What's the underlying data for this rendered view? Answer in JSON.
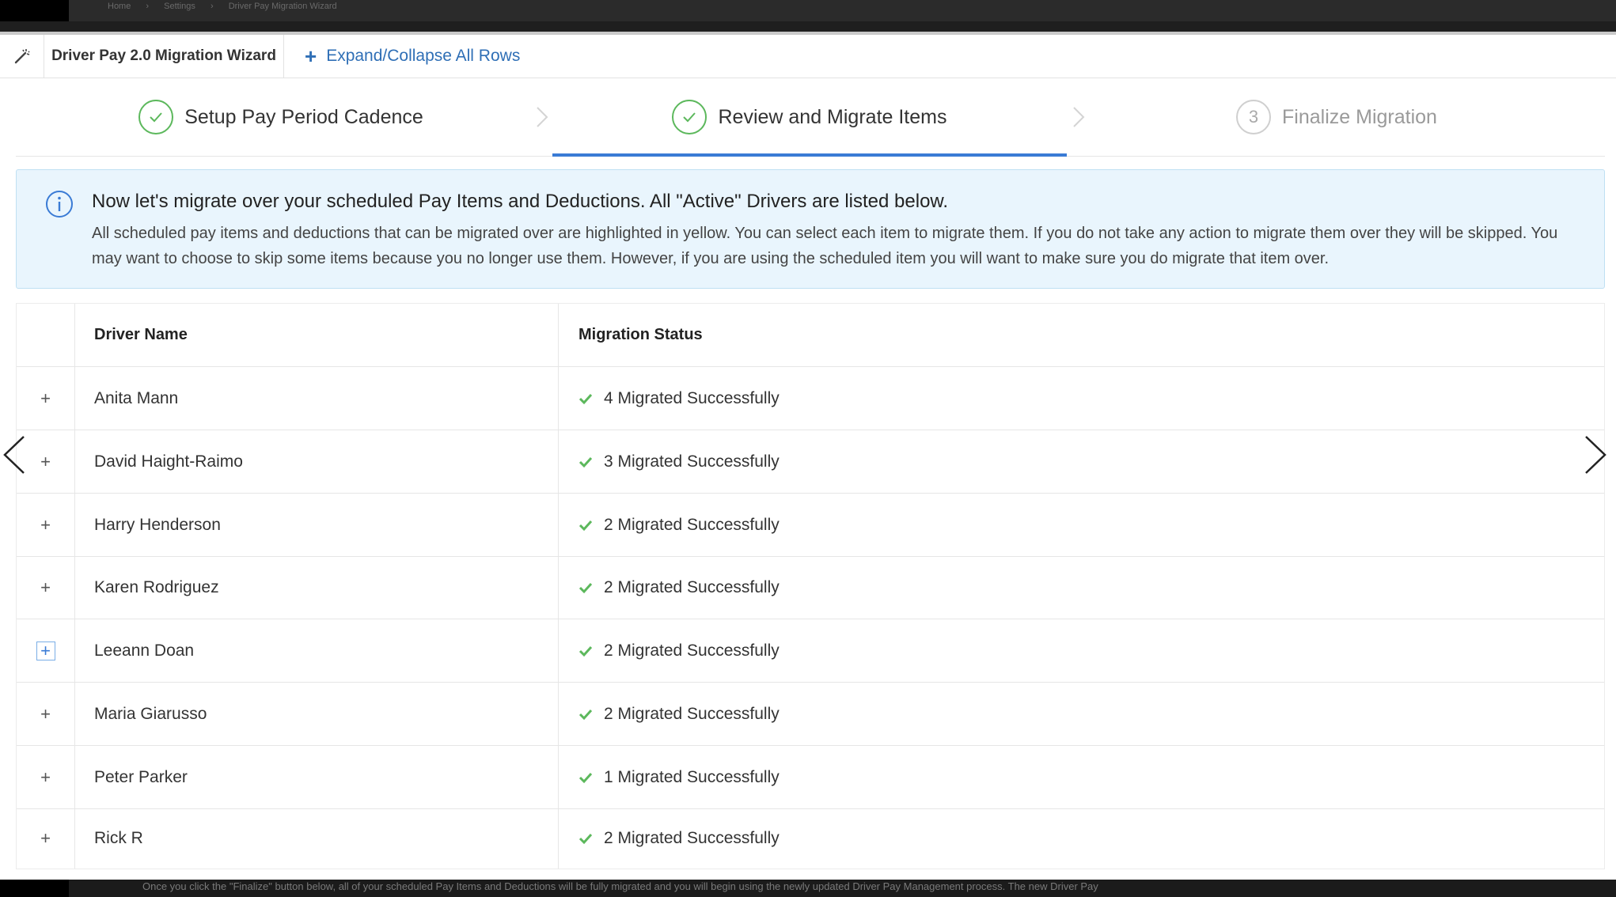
{
  "topbar": {
    "breadcrumbs": [
      "Home",
      "Settings",
      "Driver Pay Migration Wizard"
    ]
  },
  "header": {
    "icon": "magic-wand-icon",
    "title": "Driver Pay 2.0 Migration Wizard",
    "expand_label": "Expand/Collapse All Rows"
  },
  "steps": [
    {
      "label": "Setup Pay Period Cadence",
      "state": "complete"
    },
    {
      "label": "Review and Migrate Items",
      "state": "active"
    },
    {
      "label": "Finalize Migration",
      "state": "pending",
      "number": "3"
    }
  ],
  "info": {
    "title": "Now let's migrate over your scheduled Pay Items and Deductions. All \"Active\" Drivers are listed below.",
    "body": "All scheduled pay items and deductions that can be migrated over are highlighted in yellow. You can select each item to migrate them. If you do not take any action to migrate them over they will be skipped. You may want to choose to skip some items because you no longer use them. However, if you are using the scheduled item you will want to make sure you do migrate that item over."
  },
  "table": {
    "columns": {
      "name": "Driver Name",
      "status": "Migration Status"
    },
    "rows": [
      {
        "name": "Anita Mann",
        "status": "4 Migrated Successfully"
      },
      {
        "name": "David Haight-Raimo",
        "status": "3 Migrated Successfully"
      },
      {
        "name": "Harry Henderson",
        "status": "2 Migrated Successfully"
      },
      {
        "name": "Karen Rodriguez",
        "status": "2 Migrated Successfully"
      },
      {
        "name": "Leeann Doan",
        "status": "2 Migrated Successfully"
      },
      {
        "name": "Maria Giarusso",
        "status": "2 Migrated Successfully"
      },
      {
        "name": "Peter Parker",
        "status": "1 Migrated Successfully"
      },
      {
        "name": "Rick R",
        "status": "2 Migrated Successfully"
      }
    ]
  },
  "footer": {
    "text": "Once you click the \"Finalize\" button below, all of your scheduled Pay Items and Deductions will be fully migrated and you will begin using the newly updated Driver Pay Management process. The new Driver Pay"
  },
  "colors": {
    "accent": "#3a7bd5",
    "link": "#2f6fb6",
    "success": "#5cb85c",
    "info_bg": "#e9f5fd"
  }
}
